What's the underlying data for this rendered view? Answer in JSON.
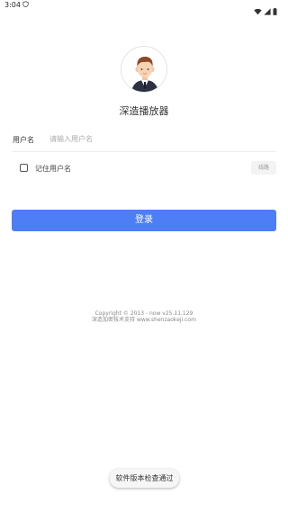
{
  "status_bar": {
    "time": "3:04",
    "notification_icon": "shield-icon",
    "icons": [
      "wifi-icon",
      "signal-icon",
      "battery-icon"
    ]
  },
  "header": {
    "avatar_icon": "user-avatar-icon",
    "app_title": "深造播放器"
  },
  "form": {
    "username_label": "用户名",
    "username_placeholder": "请输入用户名",
    "username_value": "",
    "remember_label": "记住用户名",
    "remember_checked": false,
    "route_button_label": "线路",
    "login_button_label": "登录"
  },
  "footer": {
    "copyright": "Copyright © 2013 - now v25.11.129",
    "support": "深造加密技术支持 www.shenzaokeji.com"
  },
  "toast": {
    "message": "软件版本检查通过"
  },
  "colors": {
    "primary": "#4e7ef6",
    "background": "#ffffff"
  }
}
